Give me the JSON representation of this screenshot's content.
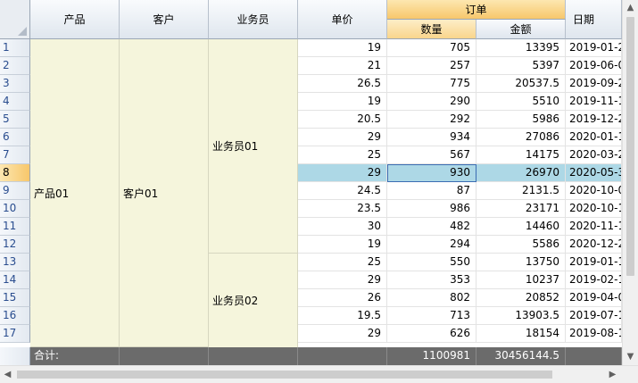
{
  "headers": {
    "product": "产品",
    "customer": "客户",
    "salesperson": "业务员",
    "unit_price": "单价",
    "order_group": "订单",
    "quantity": "数量",
    "amount": "金额",
    "date": "日期"
  },
  "merged": {
    "product": "产品01",
    "customer": "客户01",
    "salesperson_1": "业务员01",
    "salesperson_2": "业务员02"
  },
  "row_numbers": [
    "1",
    "2",
    "3",
    "4",
    "5",
    "6",
    "7",
    "8",
    "9",
    "10",
    "11",
    "12",
    "13",
    "14",
    "15",
    "16",
    "17"
  ],
  "selected_row": 8,
  "rows": [
    {
      "price": "19",
      "qty": "705",
      "amount": "13395",
      "date": "2019-01-2"
    },
    {
      "price": "21",
      "qty": "257",
      "amount": "5397",
      "date": "2019-06-0"
    },
    {
      "price": "26.5",
      "qty": "775",
      "amount": "20537.5",
      "date": "2019-09-2"
    },
    {
      "price": "19",
      "qty": "290",
      "amount": "5510",
      "date": "2019-11-1"
    },
    {
      "price": "20.5",
      "qty": "292",
      "amount": "5986",
      "date": "2019-12-2"
    },
    {
      "price": "29",
      "qty": "934",
      "amount": "27086",
      "date": "2020-01-1"
    },
    {
      "price": "25",
      "qty": "567",
      "amount": "14175",
      "date": "2020-03-2"
    },
    {
      "price": "29",
      "qty": "930",
      "amount": "26970",
      "date": "2020-05-3"
    },
    {
      "price": "24.5",
      "qty": "87",
      "amount": "2131.5",
      "date": "2020-10-0"
    },
    {
      "price": "23.5",
      "qty": "986",
      "amount": "23171",
      "date": "2020-10-1"
    },
    {
      "price": "30",
      "qty": "482",
      "amount": "14460",
      "date": "2020-11-1"
    },
    {
      "price": "19",
      "qty": "294",
      "amount": "5586",
      "date": "2020-12-2"
    },
    {
      "price": "25",
      "qty": "550",
      "amount": "13750",
      "date": "2019-01-1"
    },
    {
      "price": "29",
      "qty": "353",
      "amount": "10237",
      "date": "2019-02-1"
    },
    {
      "price": "26",
      "qty": "802",
      "amount": "20852",
      "date": "2019-04-0"
    },
    {
      "price": "19.5",
      "qty": "713",
      "amount": "13903.5",
      "date": "2019-07-1"
    },
    {
      "price": "29",
      "qty": "626",
      "amount": "18154",
      "date": "2019-08-1"
    }
  ],
  "footer": {
    "label": "合计:",
    "total_qty": "1100981",
    "total_amount": "30456144.5"
  },
  "scrollbars": {
    "up_icon": "arrow-up-icon",
    "down_icon": "arrow-down-icon",
    "left_icon": "arrow-left-icon",
    "right_icon": "arrow-right-icon"
  }
}
